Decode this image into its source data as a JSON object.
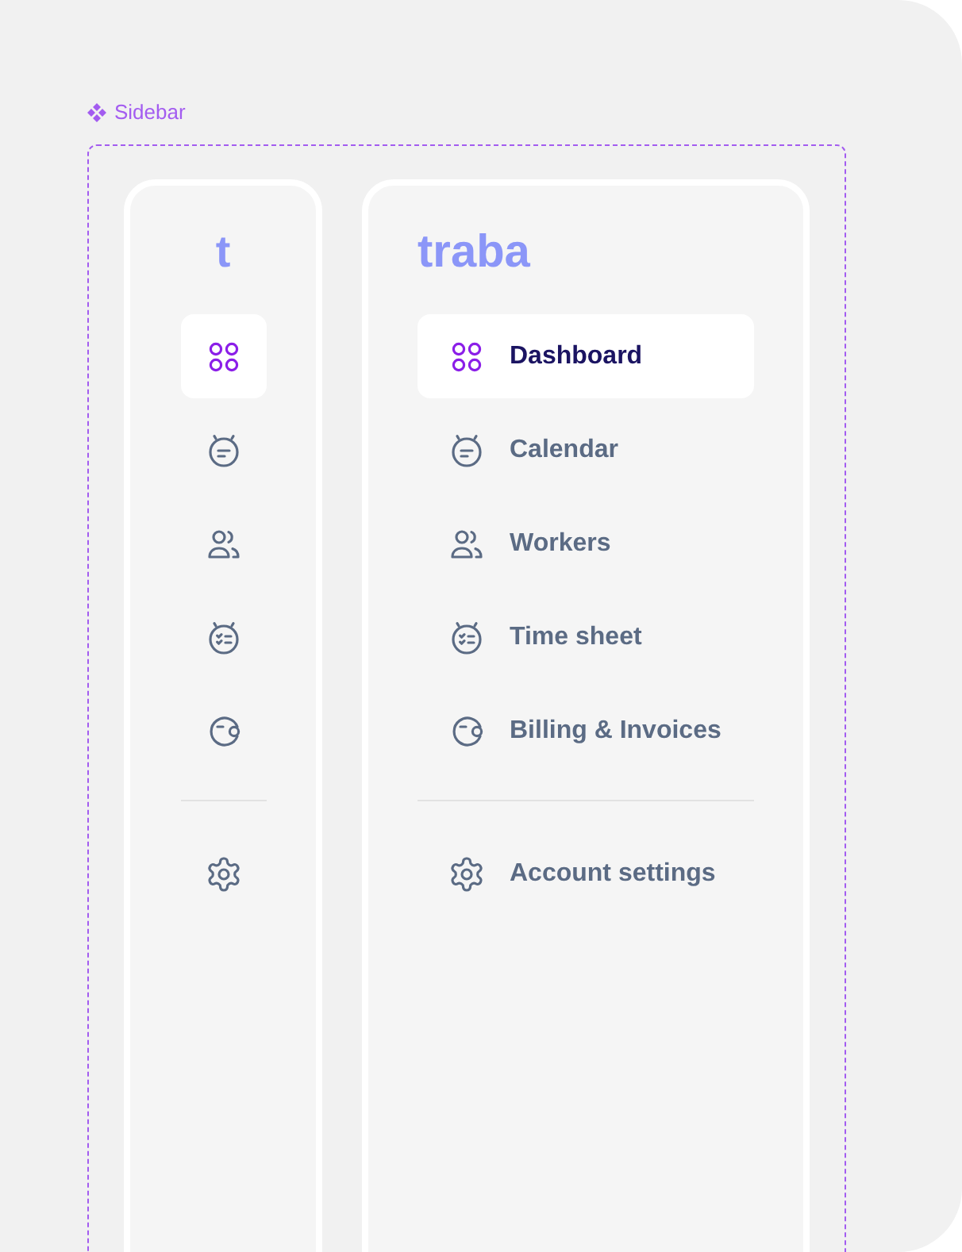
{
  "frame_label": "Sidebar",
  "collapsed": {
    "logo": "t",
    "items": [
      {
        "selected": true
      },
      {
        "selected": false
      },
      {
        "selected": false
      },
      {
        "selected": false
      },
      {
        "selected": false
      }
    ]
  },
  "expanded": {
    "logo": "traba",
    "items": [
      {
        "label": "Dashboard",
        "selected": true
      },
      {
        "label": "Calendar",
        "selected": false
      },
      {
        "label": "Workers",
        "selected": false
      },
      {
        "label": "Time sheet",
        "selected": false
      },
      {
        "label": "Billing & Invoices",
        "selected": false
      }
    ],
    "settings": {
      "label": "Account settings"
    }
  }
}
